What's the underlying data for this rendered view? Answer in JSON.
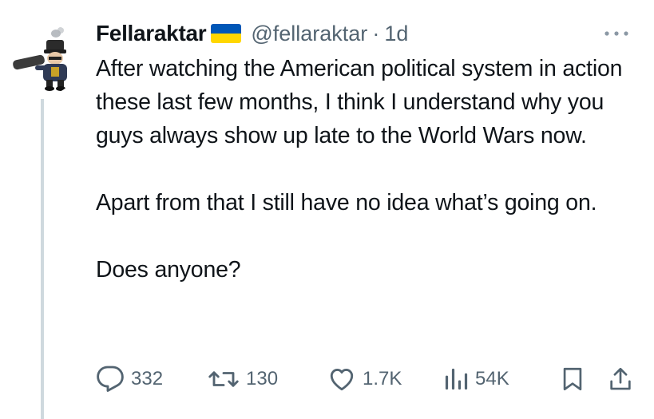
{
  "author": {
    "display_name": "Fellaraktar",
    "handle": "@fellaraktar",
    "separator": "·",
    "time": "1d",
    "flag": "ukraine-flag-icon"
  },
  "tweet": {
    "paragraphs": [
      "After watching the American political system in action these last few months, I think I understand why you guys always show up late to the World Wars now.",
      "Apart from that I still have no idea what’s going on.",
      "Does anyone?"
    ]
  },
  "actions": {
    "replies": "332",
    "retweets": "130",
    "likes": "1.7K",
    "views": "54K"
  },
  "colors": {
    "text": "#0f1419",
    "secondary": "#536471",
    "thread_line": "#cfd9de",
    "flag_blue": "#0057b7",
    "flag_yellow": "#ffd700"
  }
}
